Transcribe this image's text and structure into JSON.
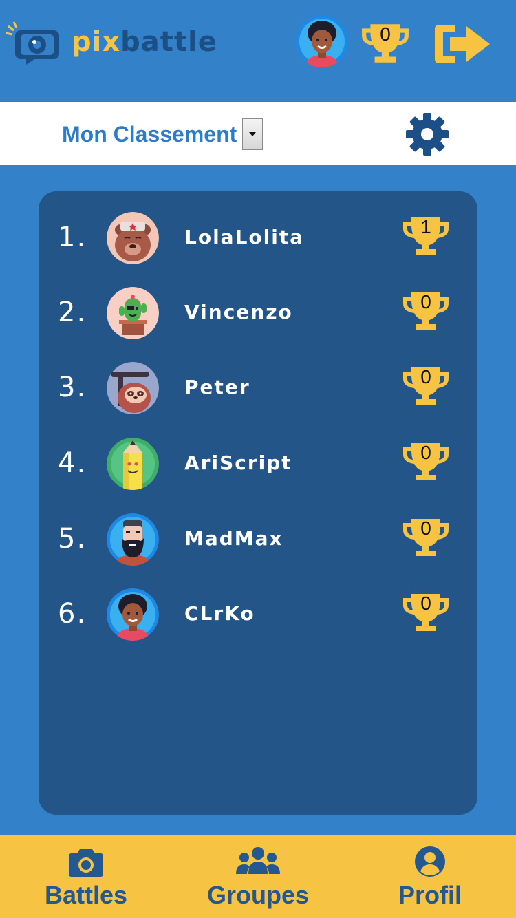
{
  "app": {
    "logo_part1": "pix",
    "logo_part2": "battle"
  },
  "header": {
    "trophy_count": "0",
    "avatar_icon": "afro-person-avatar",
    "trophy_icon": "trophy-icon",
    "logout_icon": "logout-arrow-icon"
  },
  "ranking": {
    "select_label": "Mon Classement",
    "settings_icon": "gear-icon"
  },
  "leaderboard": [
    {
      "rank": "1.",
      "name": "LolaLolita",
      "trophies": "1",
      "avatar": "bear-avatar"
    },
    {
      "rank": "2.",
      "name": "Vincenzo",
      "trophies": "0",
      "avatar": "cactus-avatar"
    },
    {
      "rank": "3.",
      "name": "Peter",
      "trophies": "0",
      "avatar": "sloth-avatar"
    },
    {
      "rank": "4.",
      "name": "AriScript",
      "trophies": "0",
      "avatar": "pencil-avatar"
    },
    {
      "rank": "5.",
      "name": "MadMax",
      "trophies": "0",
      "avatar": "bearded-man-avatar"
    },
    {
      "rank": "6.",
      "name": "CLrKo",
      "trophies": "0",
      "avatar": "afro-person-avatar"
    }
  ],
  "nav": {
    "battles": "Battles",
    "groupes": "Groupes",
    "profil": "Profil"
  },
  "colors": {
    "background": "#3281c9",
    "card": "#245588",
    "accent_yellow": "#f6c342",
    "nav_text": "#24588f"
  }
}
